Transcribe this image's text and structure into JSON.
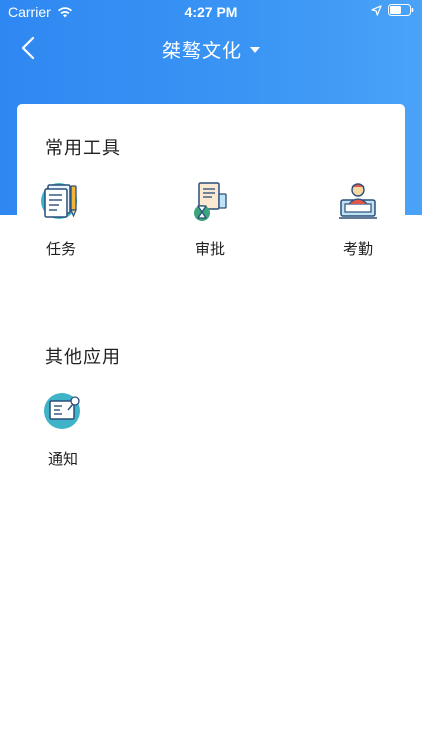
{
  "status_bar": {
    "carrier": "Carrier",
    "time": "4:27 PM"
  },
  "nav": {
    "title": "桀骜文化"
  },
  "common_tools": {
    "title": "常用工具",
    "items": [
      {
        "label": "任务",
        "icon": "task-list-icon"
      },
      {
        "label": "审批",
        "icon": "approval-icon"
      },
      {
        "label": "考勤",
        "icon": "attendance-icon"
      }
    ]
  },
  "other_apps": {
    "title": "其他应用",
    "items": [
      {
        "label": "通知",
        "icon": "notice-icon"
      }
    ]
  },
  "colors": {
    "header_blue": "#2f88f2",
    "icon_teal": "#3fb3c8",
    "icon_blue": "#2a6fb8"
  }
}
